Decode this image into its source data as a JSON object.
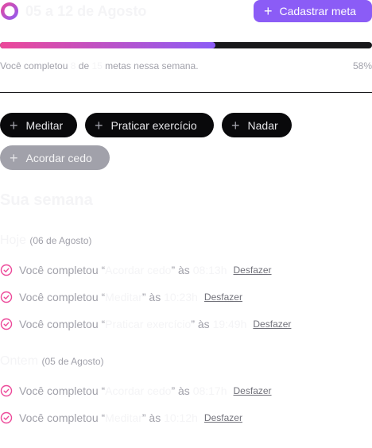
{
  "header": {
    "week_start": "05",
    "week_separator": "a",
    "week_end": "12 de Agosto",
    "cta_label": "Cadastrar meta",
    "cta_icon": "plus-icon"
  },
  "summary": {
    "prefix": "Você completou",
    "completed": "8",
    "of_word": "de",
    "total": "15",
    "suffix": "metas nessa semana.",
    "percent_label": "58%",
    "progress_fraction": 0.58
  },
  "pending_goals": [
    {
      "label": "Meditar",
      "enabled": true
    },
    {
      "label": "Praticar exercício",
      "enabled": true
    },
    {
      "label": "Nadar",
      "enabled": true
    },
    {
      "label": "Acordar cedo",
      "enabled": false
    }
  ],
  "week": {
    "title": "Sua semana",
    "days": [
      {
        "name": "Hoje",
        "date": "(06 de Agosto)",
        "entries": [
          {
            "prefix": "Você completou “",
            "goal": "Acordar cedo",
            "middle": "” às",
            "time": "08:13h",
            "undo": "Desfazer"
          },
          {
            "prefix": "Você completou “",
            "goal": "Meditar",
            "middle": "” às",
            "time": "10:23h",
            "undo": "Desfazer"
          },
          {
            "prefix": "Você completou “",
            "goal": "Praticar exercício",
            "middle": "” às",
            "time": "19:49h",
            "undo": "Desfazer"
          }
        ]
      },
      {
        "name": "Ontem",
        "date": "(05 de Agosto)",
        "entries": [
          {
            "prefix": "Você completou “",
            "goal": "Acordar cedo",
            "middle": "” às",
            "time": "08:17h",
            "undo": "Desfazer"
          },
          {
            "prefix": "Você completou “",
            "goal": "Meditar",
            "middle": "” às",
            "time": "10:12h",
            "undo": "Desfazer"
          }
        ]
      }
    ]
  },
  "colors": {
    "accent": "#8b5cf6",
    "accent_pink": "#ec4899",
    "chip_bg": "#09090b",
    "chip_disabled_bg": "#a1a1aa",
    "muted_text": "#a1a1aa"
  }
}
